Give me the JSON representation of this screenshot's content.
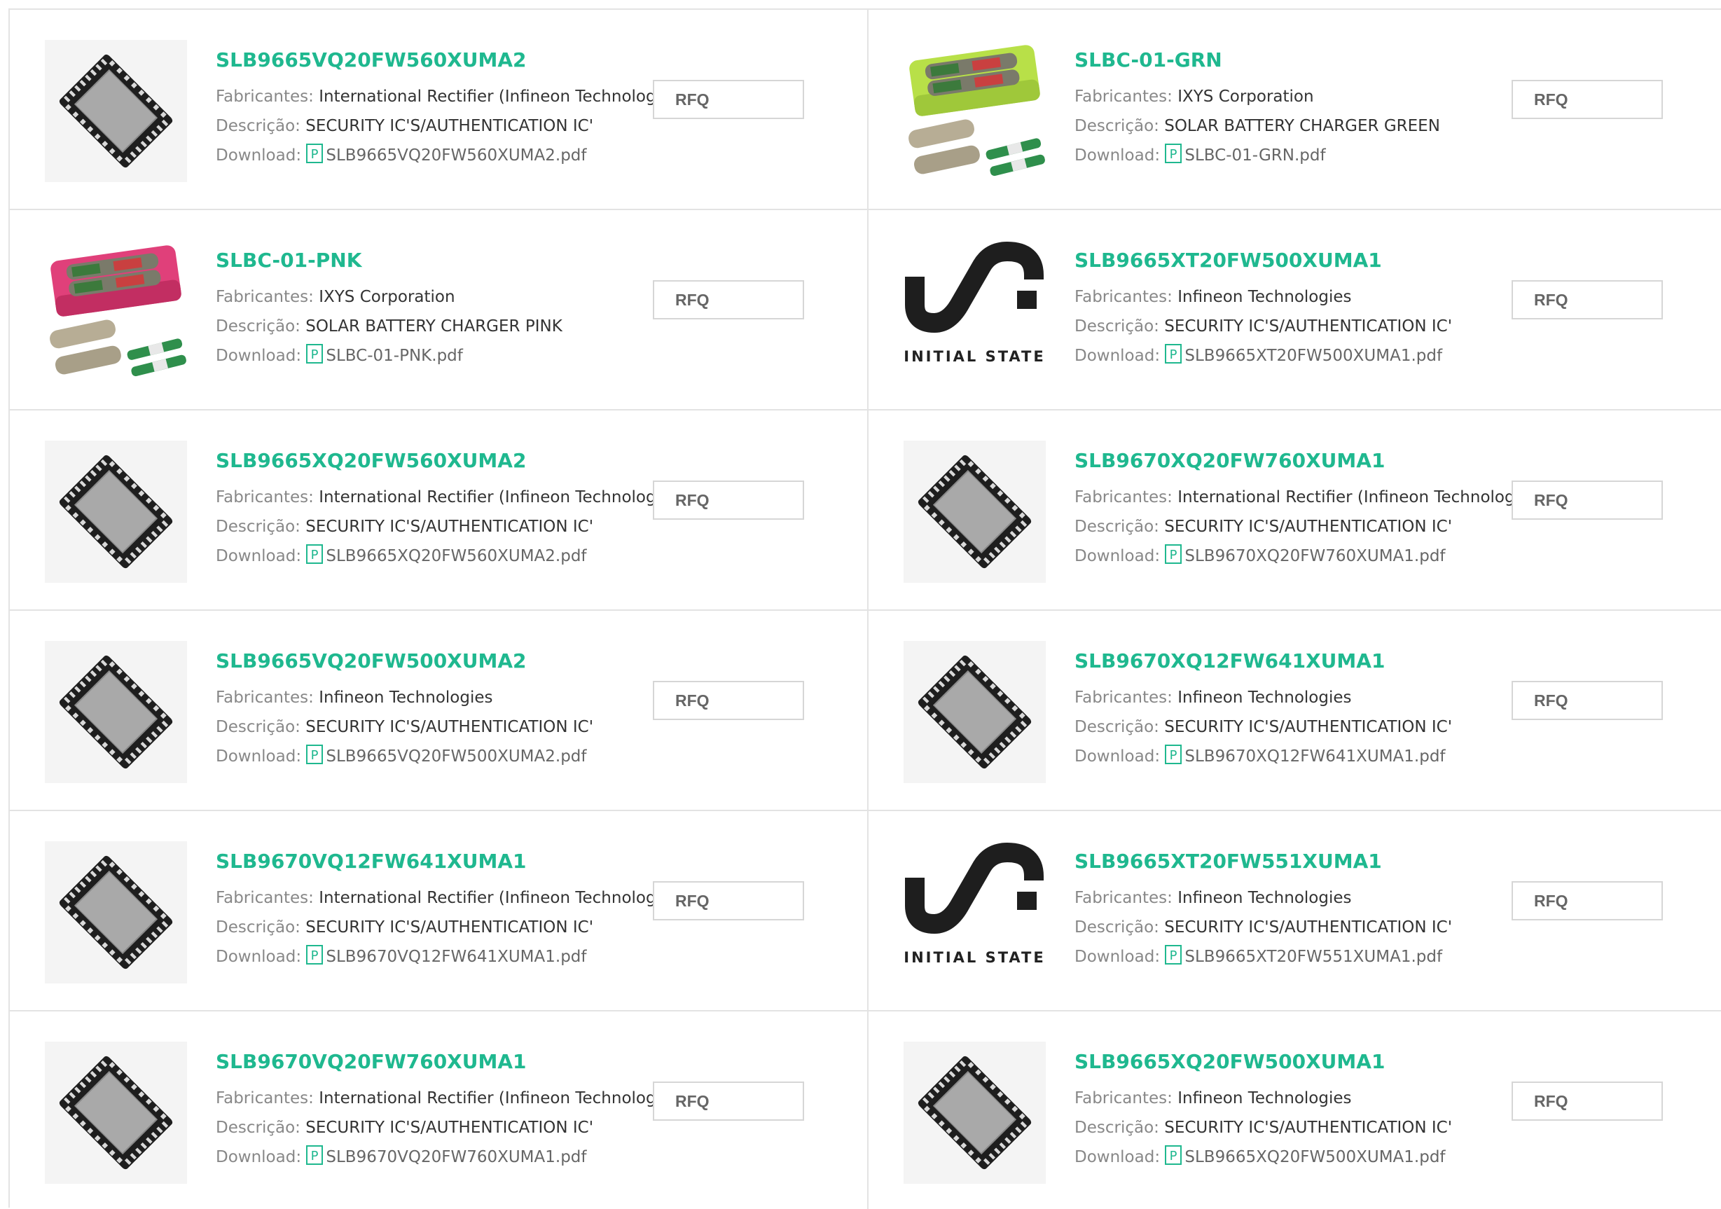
{
  "labels": {
    "manufacturer": "Fabricantes:",
    "description": "Descrição:",
    "download": "Download:",
    "rfq": "RFQ"
  },
  "colors": {
    "part_number": "#1fb88f",
    "label": "#888888",
    "border": "#e3e3e3"
  },
  "products": [
    {
      "part_number": "SLB9665VQ20FW560XUMA2",
      "manufacturer": "International Rectifier (Infineon Technologies)",
      "description": "SECURITY IC'S/AUTHENTICATION IC'",
      "pdf": "SLB9665VQ20FW560XUMA2.pdf",
      "image": "qfn-chip"
    },
    {
      "part_number": "SLBC-01-GRN",
      "manufacturer": "IXYS Corporation",
      "description": "SOLAR BATTERY CHARGER GREEN",
      "pdf": "SLBC-01-GRN.pdf",
      "image": "battery-charger-green"
    },
    {
      "part_number": "SLBC-01-PNK",
      "manufacturer": "IXYS Corporation",
      "description": "SOLAR BATTERY CHARGER PINK",
      "pdf": "SLBC-01-PNK.pdf",
      "image": "battery-charger-pink"
    },
    {
      "part_number": "SLB9665XT20FW500XUMA1",
      "manufacturer": "Infineon Technologies",
      "description": "SECURITY IC'S/AUTHENTICATION IC'",
      "pdf": "SLB9665XT20FW500XUMA1.pdf",
      "image": "initial-state-logo",
      "logo_text": "INITIAL STATE"
    },
    {
      "part_number": "SLB9665XQ20FW560XUMA2",
      "manufacturer": "International Rectifier (Infineon Technologies)",
      "description": "SECURITY IC'S/AUTHENTICATION IC'",
      "pdf": "SLB9665XQ20FW560XUMA2.pdf",
      "image": "qfn-chip"
    },
    {
      "part_number": "SLB9670XQ20FW760XUMA1",
      "manufacturer": "International Rectifier (Infineon Technologies)",
      "description": "SECURITY IC'S/AUTHENTICATION IC'",
      "pdf": "SLB9670XQ20FW760XUMA1.pdf",
      "image": "qfn-chip"
    },
    {
      "part_number": "SLB9665VQ20FW500XUMA2",
      "manufacturer": "Infineon Technologies",
      "description": "SECURITY IC'S/AUTHENTICATION IC'",
      "pdf": "SLB9665VQ20FW500XUMA2.pdf",
      "image": "qfn-chip"
    },
    {
      "part_number": "SLB9670XQ12FW641XUMA1",
      "manufacturer": "Infineon Technologies",
      "description": "SECURITY IC'S/AUTHENTICATION IC'",
      "pdf": "SLB9670XQ12FW641XUMA1.pdf",
      "image": "qfn-chip"
    },
    {
      "part_number": "SLB9670VQ12FW641XUMA1",
      "manufacturer": "International Rectifier (Infineon Technologies)",
      "description": "SECURITY IC'S/AUTHENTICATION IC'",
      "pdf": "SLB9670VQ12FW641XUMA1.pdf",
      "image": "qfn-chip"
    },
    {
      "part_number": "SLB9665XT20FW551XUMA1",
      "manufacturer": "Infineon Technologies",
      "description": "SECURITY IC'S/AUTHENTICATION IC'",
      "pdf": "SLB9665XT20FW551XUMA1.pdf",
      "image": "initial-state-logo",
      "logo_text": "INITIAL STATE"
    },
    {
      "part_number": "SLB9670VQ20FW760XUMA1",
      "manufacturer": "International Rectifier (Infineon Technologies)",
      "description": "SECURITY IC'S/AUTHENTICATION IC'",
      "pdf": "SLB9670VQ20FW760XUMA1.pdf",
      "image": "qfn-chip"
    },
    {
      "part_number": "SLB9665XQ20FW500XUMA1",
      "manufacturer": "Infineon Technologies",
      "description": "SECURITY IC'S/AUTHENTICATION IC'",
      "pdf": "SLB9665XQ20FW500XUMA1.pdf",
      "image": "qfn-chip"
    }
  ]
}
